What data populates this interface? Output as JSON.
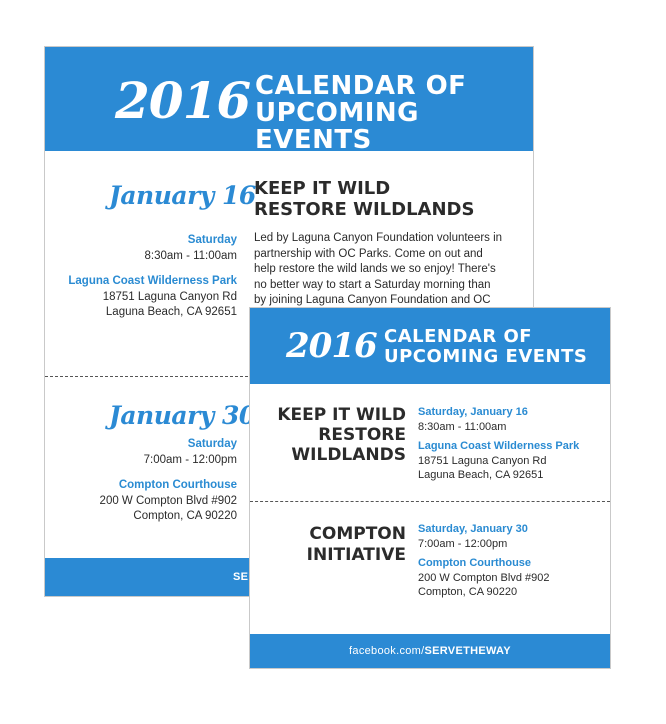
{
  "back_card": {
    "header": {
      "year": "2016",
      "title_line1": "CALENDAR OF",
      "title_line2": "UPCOMING EVENTS"
    },
    "event1": {
      "date": "January 16",
      "title_line1": "KEEP IT WILD",
      "title_line2": "RESTORE WILDLANDS",
      "day": "Saturday",
      "time": "8:30am - 11:00am",
      "venue": "Laguna Coast Wilderness Park",
      "address1": "18751 Laguna Canyon Rd",
      "address2": "Laguna Beach, CA 92651",
      "description": "Led by Laguna Canyon Foundation volunteers in partnership with OC Parks. Come on out and help restore the wild lands we so enjoy! There's no better way to start a Saturday morning than by joining Laguna Canyon Foundation and OC Parks staff in an invigorating project of"
    },
    "event2": {
      "date": "January 30",
      "day": "Saturday",
      "time": "7:00am - 12:00pm",
      "venue": "Compton Courthouse",
      "address1": "200 W Compton Blvd #902",
      "address2": "Compton, CA 90220"
    },
    "footer_partial": "SERVE"
  },
  "front_card": {
    "header": {
      "year": "2016",
      "title_line1": "CALENDAR OF",
      "title_line2": "UPCOMING EVENTS"
    },
    "event1": {
      "title_line1": "KEEP IT WILD",
      "title_line2": "RESTORE",
      "title_line3": "WILDLANDS",
      "date": "Saturday, January 16",
      "time": "8:30am - 11:00am",
      "venue": "Laguna Coast Wilderness Park",
      "address1": "18751 Laguna Canyon Rd",
      "address2": "Laguna Beach, CA 92651"
    },
    "event2": {
      "title_line1": "COMPTON",
      "title_line2": "INITIATIVE",
      "date": "Saturday, January 30",
      "time": "7:00am - 12:00pm",
      "venue": "Compton Courthouse",
      "address1": "200 W Compton Blvd #902",
      "address2": "Compton, CA 90220"
    },
    "footer": {
      "prefix": "facebook.com/",
      "handle": "SERVETHEWAY"
    }
  },
  "colors": {
    "accent_blue": "#2b8ad4",
    "text_dark": "#2b2b2b"
  }
}
